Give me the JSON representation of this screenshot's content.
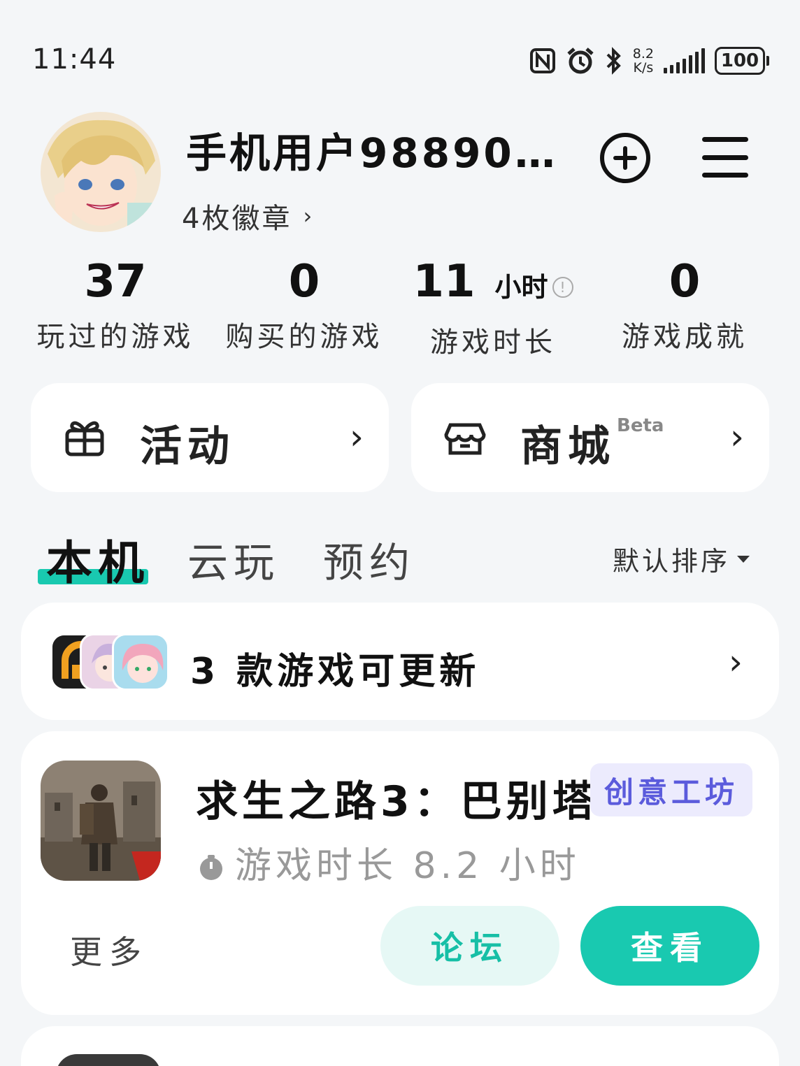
{
  "status_bar": {
    "time": "11:44",
    "net_speed_value": "8.2",
    "net_speed_unit": "K/s",
    "battery": "100",
    "icons": [
      "nfc-icon",
      "alarm-icon",
      "bluetooth-icon",
      "signal-icon",
      "battery-icon"
    ]
  },
  "profile": {
    "username": "手机用户98890…",
    "badges_text": "4枚徽章",
    "badges_chevron": "›"
  },
  "stats": [
    {
      "value": "37",
      "unit": "",
      "label": "玩过的游戏"
    },
    {
      "value": "0",
      "unit": "",
      "label": "购买的游戏"
    },
    {
      "value": "11",
      "unit": "小时",
      "label": "游戏时长"
    },
    {
      "value": "0",
      "unit": "",
      "label": "游戏成就"
    }
  ],
  "quick_links": {
    "activity": {
      "label": "活动",
      "chevron": "›"
    },
    "shop": {
      "label": "商城",
      "badge": "Beta",
      "chevron": "›"
    }
  },
  "tabs": [
    {
      "label": "本机",
      "active": true
    },
    {
      "label": "云玩",
      "active": false
    },
    {
      "label": "预约",
      "active": false
    }
  ],
  "sort": {
    "label": "默认排序"
  },
  "update_banner": {
    "text": "3 款游戏可更新",
    "chevron": "›",
    "count": 3
  },
  "game": {
    "title": "求生之路3：巴别塔",
    "tag": "创意工坊",
    "playtime": "游戏时长 8.2 小时",
    "more_label": "更多",
    "forum_label": "论坛",
    "view_label": "查看"
  },
  "colors": {
    "accent": "#19c9b0",
    "background": "#f4f6f8",
    "tag_bg": "#ecebfd",
    "tag_text": "#5b5bdc"
  }
}
